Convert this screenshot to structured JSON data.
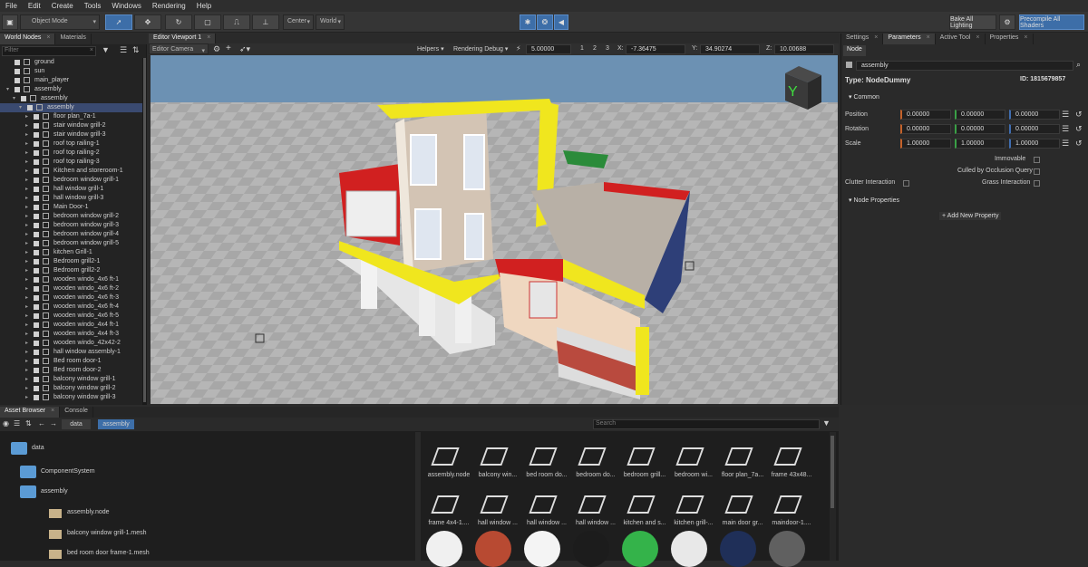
{
  "menu": [
    "File",
    "Edit",
    "Create",
    "Tools",
    "Windows",
    "Rendering",
    "Help"
  ],
  "toolbar": {
    "mode": "Object Mode",
    "pivot": "Center",
    "space": "World",
    "bake": "Bake All Lighting",
    "precompile": "Precompile All Shaders"
  },
  "left_tabs": [
    "World Nodes",
    "Materials"
  ],
  "filter_placeholder": "Filter",
  "tree": [
    {
      "label": "ground",
      "indent": 0,
      "sel": false
    },
    {
      "label": "sun",
      "indent": 0,
      "sel": false
    },
    {
      "label": "main_player",
      "indent": 0,
      "sel": false
    },
    {
      "label": "assembly",
      "indent": 0,
      "sel": false
    },
    {
      "label": "assembly",
      "indent": 1,
      "sel": false
    },
    {
      "label": "assembly",
      "indent": 2,
      "sel": true
    },
    {
      "label": "floor plan_7a-1",
      "indent": 3
    },
    {
      "label": "stair window grill-2",
      "indent": 3
    },
    {
      "label": "stair window grill-3",
      "indent": 3
    },
    {
      "label": "roof top railing-1",
      "indent": 3
    },
    {
      "label": "roof top railing-2",
      "indent": 3
    },
    {
      "label": "roof top railing-3",
      "indent": 3
    },
    {
      "label": "Kitchen and storeroom-1",
      "indent": 3
    },
    {
      "label": "bedroom window grill-1",
      "indent": 3
    },
    {
      "label": "hall window grill-1",
      "indent": 3
    },
    {
      "label": "hall window grill-3",
      "indent": 3
    },
    {
      "label": "Main Door-1",
      "indent": 3
    },
    {
      "label": "bedroom window grill-2",
      "indent": 3
    },
    {
      "label": "bedroom window grill-3",
      "indent": 3
    },
    {
      "label": "bedroom window grill-4",
      "indent": 3
    },
    {
      "label": "bedroom window grill-5",
      "indent": 3
    },
    {
      "label": "kitchen Grill-1",
      "indent": 3
    },
    {
      "label": "Bedroom grill2-1",
      "indent": 3
    },
    {
      "label": "Bedroom grill2-2",
      "indent": 3
    },
    {
      "label": "wooden windo_4x6 ft-1",
      "indent": 3
    },
    {
      "label": "wooden windo_4x6 ft-2",
      "indent": 3
    },
    {
      "label": "wooden windo_4x6 ft-3",
      "indent": 3
    },
    {
      "label": "wooden windo_4x6 ft-4",
      "indent": 3
    },
    {
      "label": "wooden windo_4x6 ft-5",
      "indent": 3
    },
    {
      "label": "wooden windo_4x4 ft-1",
      "indent": 3
    },
    {
      "label": "wooden windo_4x4 ft-3",
      "indent": 3
    },
    {
      "label": "wooden windo_42x42-2",
      "indent": 3
    },
    {
      "label": "hall window assembly-1",
      "indent": 3
    },
    {
      "label": "Bed room door-1",
      "indent": 3
    },
    {
      "label": "Bed room door-2",
      "indent": 3
    },
    {
      "label": "balcony window grill-1",
      "indent": 3
    },
    {
      "label": "balcony window grill-2",
      "indent": 3
    },
    {
      "label": "balcony window grill-3",
      "indent": 3
    }
  ],
  "viewport": {
    "tab": "Editor Viewport 1",
    "camera": "Editor Camera",
    "helpers": "Helpers",
    "debug": "Rendering Debug",
    "speed": "5.00000",
    "x": "-7.36475",
    "y": "34.90274",
    "z": "10.00688",
    "nums": [
      "1",
      "2",
      "3"
    ],
    "axis": "Y"
  },
  "right_tabs": [
    "Settings",
    "Parameters",
    "Active Tool",
    "Properties"
  ],
  "params": {
    "node_tab": "Node",
    "name": "assembly",
    "type": "Type: NodeDummy",
    "id": "ID: 1815679857",
    "common": "Common",
    "rows": [
      {
        "label": "Position",
        "v": [
          "0.00000",
          "0.00000",
          "0.00000"
        ]
      },
      {
        "label": "Rotation",
        "v": [
          "0.00000",
          "0.00000",
          "0.00000"
        ]
      },
      {
        "label": "Scale",
        "v": [
          "1.00000",
          "1.00000",
          "1.00000"
        ]
      }
    ],
    "immovable": "Immovable",
    "culled": "Culled by Occlusion Query",
    "clutter": "Clutter Interaction",
    "grass": "Grass Interaction",
    "node_props": "Node Properties",
    "add_prop": "Add New Property"
  },
  "bottom_tabs": [
    "Asset Browser",
    "Console"
  ],
  "path": [
    "data",
    "assembly"
  ],
  "search_placeholder": "Search",
  "folders": [
    {
      "label": "data",
      "indent": 0
    },
    {
      "label": "ComponentSystem",
      "indent": 1
    },
    {
      "label": "assembly",
      "indent": 1
    },
    {
      "label": "assembly.node",
      "indent": 2
    },
    {
      "label": "balcony window grill-1.mesh",
      "indent": 2
    },
    {
      "label": "bed room door frame-1.mesh",
      "indent": 2
    }
  ],
  "assets_row1": [
    "assembly.node",
    "balcony win...",
    "bed room do...",
    "bedroom do...",
    "bedroom grill...",
    "bedroom wi...",
    "floor plan_7a...",
    "frame 43x48..."
  ],
  "assets_row2": [
    "frame 4x4-1....",
    "hall window ...",
    "hall window ...",
    "hall window ...",
    "kitchen and s...",
    "kitchen grill-...",
    "main door gr...",
    "maindoor-1...."
  ],
  "colors": {
    "accent": "#3d6ea8",
    "selection": "#3a4a70",
    "sky": "#6c91b3"
  }
}
